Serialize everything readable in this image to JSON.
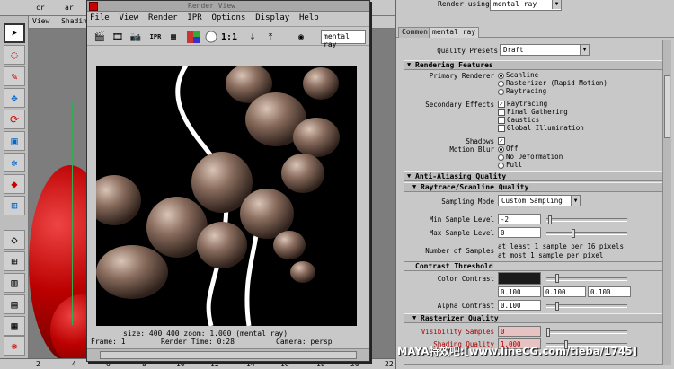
{
  "viewport": {
    "panel_menu": [
      "View",
      "Shading"
    ],
    "top_labels": [
      "cr",
      "ar"
    ],
    "timeline_ticks": [
      "2",
      "4",
      "6",
      "8",
      "10",
      "12",
      "14",
      "16",
      "18",
      "20",
      "22"
    ]
  },
  "render_window": {
    "title": "Render View",
    "menu": [
      "File",
      "View",
      "Render",
      "IPR",
      "Options",
      "Display",
      "Help"
    ],
    "toolbar_icons": [
      "clapper-icon",
      "redo-render-icon",
      "snapshot-icon",
      "ipr-icon",
      "redo-ipr-icon",
      "rgb-channels-icon",
      "alpha-icon",
      "one-to-one-icon",
      "keep-image-icon",
      "remove-image-icon",
      "renderer-icon"
    ],
    "zoom_label": "1:1",
    "renderer": "mental ray",
    "status_line1": "size:  400  400 zoom: 1.000        (mental ray)",
    "status_frame": "Frame: 1",
    "status_time": "Render Time: 0:28",
    "status_camera": "Camera: persp"
  },
  "attr": {
    "render_using_label": "Render using:",
    "render_using_value": "mental ray",
    "tabs": [
      "Common",
      "mental ray"
    ],
    "quality_presets_label": "Quality Presets",
    "quality_presets_value": "Draft",
    "sec_rendering": "Rendering Features",
    "primary_renderer_label": "Primary Renderer",
    "primary_options": [
      "Scanline",
      "Rasterizer (Rapid Motion)",
      "Raytracing"
    ],
    "secondary_label": "Secondary Effects",
    "secondary_options": [
      "Raytracing",
      "Final Gathering",
      "Caustics",
      "Global Illumination"
    ],
    "shadows_label": "Shadows",
    "motion_blur_label": "Motion Blur",
    "motion_blur_options": [
      "Off",
      "No Deformation",
      "Full"
    ],
    "sec_antialias": "Anti-Aliasing Quality",
    "sec_raytrace": "Raytrace/Scanline Quality",
    "sampling_mode_label": "Sampling Mode",
    "sampling_mode_value": "Custom Sampling",
    "min_sample_label": "Min Sample Level",
    "min_sample_value": "-2",
    "max_sample_label": "Max Sample Level",
    "max_sample_value": "0",
    "num_samples_label": "Number of Samples",
    "num_samples_line1": "at least 1 sample per 16 pixels",
    "num_samples_line2": "at most 1 sample per pixel",
    "sec_contrast": "Contrast Threshold",
    "color_contrast_label": "Color Contrast",
    "color_contrast_values": [
      "0.100",
      "0.100",
      "0.100"
    ],
    "alpha_contrast_label": "Alpha Contrast",
    "alpha_contrast_value": "0.100",
    "sec_rasterizer": "Rasterizer Quality",
    "visibility_samples_label": "Visibility Samples",
    "visibility_samples_value": "0",
    "shading_quality_label": "Shading Quality",
    "shading_quality_value": "1.000"
  },
  "watermark": "MAYA特效吧:[www.lineCG.com/tieba/1745]"
}
